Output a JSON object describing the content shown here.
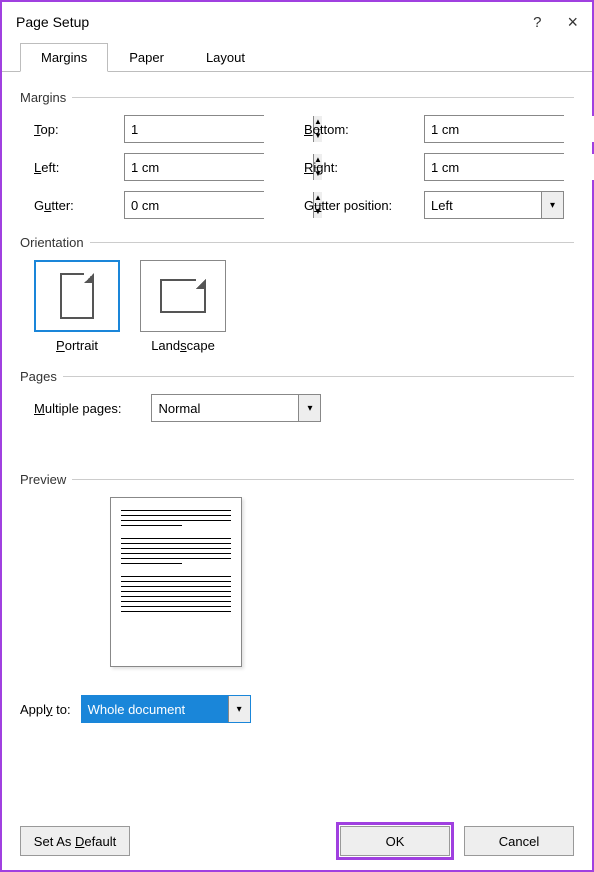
{
  "title": "Page Setup",
  "tabs": [
    "Margins",
    "Paper",
    "Layout"
  ],
  "active_tab": "Margins",
  "groups": {
    "margins": "Margins",
    "orientation": "Orientation",
    "pages": "Pages",
    "preview": "Preview"
  },
  "margins": {
    "top_label": "Top:",
    "top_value": "1",
    "bottom_label": "Bottom:",
    "bottom_value": "1 cm",
    "left_label": "Left:",
    "left_value": "1 cm",
    "right_label": "Right:",
    "right_value": "1 cm",
    "gutter_label": "Gutter:",
    "gutter_value": "0 cm",
    "gutter_pos_label": "Gutter position:",
    "gutter_pos_value": "Left"
  },
  "orientation": {
    "portrait": "Portrait",
    "landscape": "Landscape",
    "selected": "Portrait"
  },
  "pages": {
    "multi_label": "Multiple pages:",
    "multi_value": "Normal"
  },
  "apply": {
    "label": "Apply to:",
    "value": "Whole document"
  },
  "buttons": {
    "default": "Set As Default",
    "ok": "OK",
    "cancel": "Cancel"
  }
}
